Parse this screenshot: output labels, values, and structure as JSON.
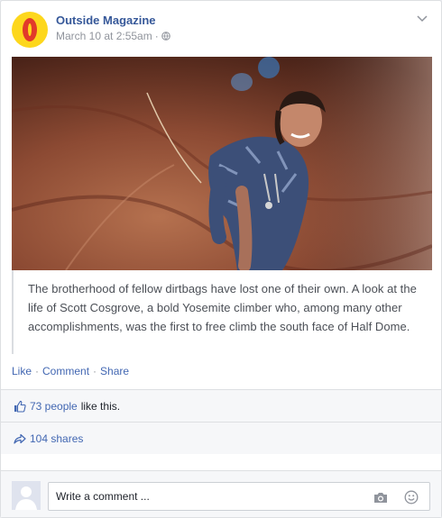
{
  "post": {
    "page_name": "Outside Magazine",
    "timestamp": "March 10 at 2:55am",
    "separator": "·",
    "audience_icon": "globe-icon",
    "menu_icon": "chevron-down-icon",
    "logo_icon": "outside-logo"
  },
  "content": {
    "caption": "The brotherhood of fellow dirtbags have lost one of their own. A look at the life of Scott Cosgrove, a bold Yosemite climber who, among many other accomplishments, was the first to free climb the south face of Half Dome."
  },
  "actions": {
    "like": "Like",
    "comment": "Comment",
    "share": "Share",
    "dot": "·"
  },
  "stats": {
    "likes_link": "73 people",
    "likes_suffix": "like this.",
    "shares": "104 shares"
  },
  "comment_box": {
    "placeholder": "Write a comment ..."
  },
  "colors": {
    "link": "#4267b2",
    "page_name": "#365899",
    "meta": "#90949c",
    "logo_yellow": "#fdd71c",
    "logo_red": "#e23a2a"
  }
}
